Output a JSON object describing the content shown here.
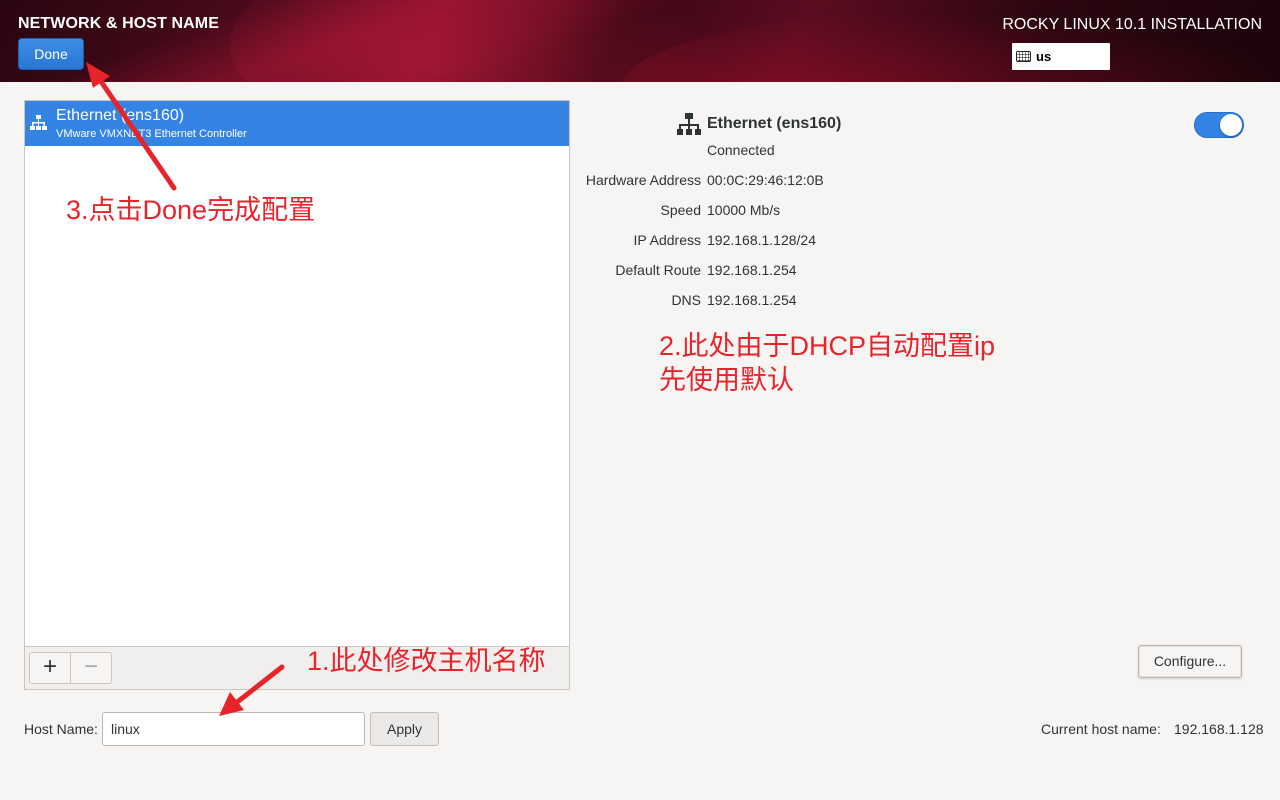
{
  "header": {
    "page_title": "NETWORK & HOST NAME",
    "done_label": "Done",
    "install_title": "ROCKY LINUX 10.1 INSTALLATION",
    "keyboard_layout": "us"
  },
  "devices": [
    {
      "name": "Ethernet (ens160)",
      "description": "VMware VMXNET3 Ethernet Controller",
      "selected": true
    }
  ],
  "toolbar": {
    "add_label": "+",
    "remove_label": "−"
  },
  "detail": {
    "name": "Ethernet (ens160)",
    "status": "Connected",
    "enabled": true,
    "properties": [
      {
        "label": "Hardware Address",
        "value": "00:0C:29:46:12:0B"
      },
      {
        "label": "Speed",
        "value": "10000 Mb/s"
      },
      {
        "label": "IP Address",
        "value": "192.168.1.128/24"
      },
      {
        "label": "Default Route",
        "value": "192.168.1.254"
      },
      {
        "label": "DNS",
        "value": "192.168.1.254"
      }
    ],
    "configure_label": "Configure..."
  },
  "hostname": {
    "label": "Host Name:",
    "value": "linux",
    "apply_label": "Apply",
    "current_label": "Current host name:",
    "current_value": "192.168.1.128"
  },
  "annotations": {
    "step1": "1.此处修改主机名称",
    "step2_line1": "2.此处由于DHCP自动配置ip",
    "step2_line2": "先使用默认",
    "step3": "3.点击Done完成配置"
  },
  "colors": {
    "accent": "#3584e4",
    "annotation": "#e8242b",
    "header_dark": "#4e0b1c"
  }
}
